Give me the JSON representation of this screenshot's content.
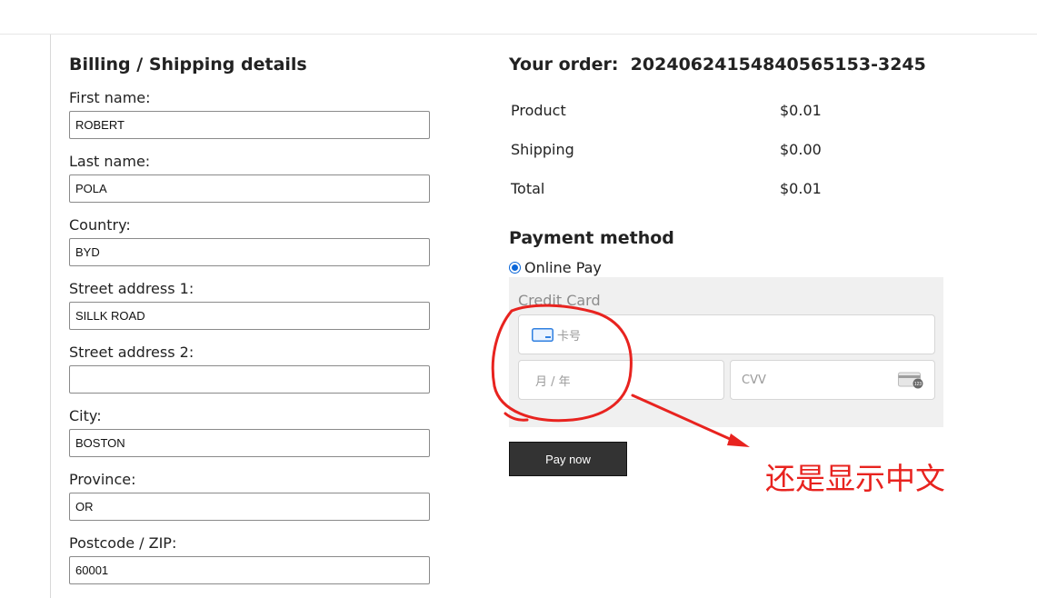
{
  "billing": {
    "title": "Billing / Shipping details",
    "fields": [
      {
        "label": "First name:",
        "value": "ROBERT"
      },
      {
        "label": "Last name:",
        "value": "POLA"
      },
      {
        "label": "Country:",
        "value": "BYD"
      },
      {
        "label": "Street address 1:",
        "value": "SILLK ROAD"
      },
      {
        "label": "Street address 2:",
        "value": ""
      },
      {
        "label": "City:",
        "value": "BOSTON"
      },
      {
        "label": "Province:",
        "value": "OR"
      },
      {
        "label": "Postcode / ZIP:",
        "value": "60001"
      }
    ]
  },
  "order": {
    "title": "Your order:  20240624154840565153-3245",
    "rows": [
      {
        "label": "Product",
        "amount": "$0.01"
      },
      {
        "label": "Shipping",
        "amount": "$0.00"
      },
      {
        "label": "Total",
        "amount": "$0.01"
      }
    ]
  },
  "payment": {
    "title": "Payment method",
    "option": "Online Pay",
    "panel_title": "Credit Card",
    "card_number_placeholder": "卡号",
    "expiry_placeholder": "月 / 年",
    "cvv_placeholder": "CVV",
    "pay_button": "Pay now"
  },
  "annotation": {
    "text": "还是显示中文",
    "color": "#e8231f"
  },
  "icons": [
    "credit-card-icon",
    "cvv-card-icon"
  ]
}
